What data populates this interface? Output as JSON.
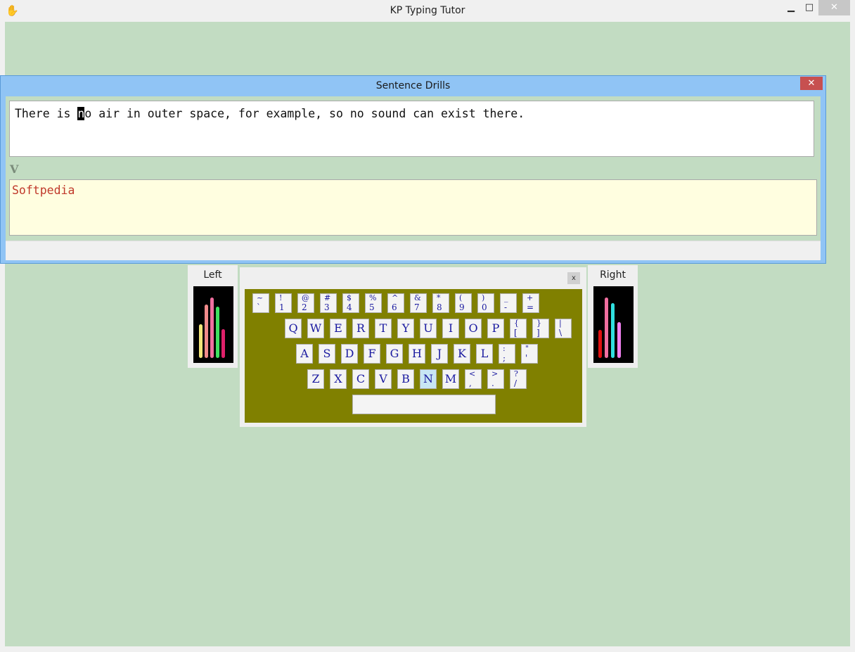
{
  "window": {
    "title": "KP Typing Tutor",
    "icon": "hand-icon",
    "minimize": "▁",
    "maximize": "□",
    "close": "✕"
  },
  "drills": {
    "title": "Sentence Drills",
    "close": "✕",
    "target_before": "There is ",
    "target_cursor": "n",
    "target_after": "o air in outer space, for example, so no sound can exist there.",
    "next_char": "V",
    "typed_text": "Softpedia",
    "status_text": ""
  },
  "fingers": {
    "left_label": "Left",
    "right_label": "Right",
    "left_bars": [
      {
        "color": "#f2e57a",
        "level": 0.5
      },
      {
        "color": "#f08a8a",
        "level": 0.8
      },
      {
        "color": "#f06fa0",
        "level": 0.9
      },
      {
        "color": "#40e060",
        "level": 0.77
      },
      {
        "color": "#e0206a",
        "level": 0.43
      }
    ],
    "right_bars": [
      {
        "color": "#e01010",
        "level": 0.42
      },
      {
        "color": "#f06fa0",
        "level": 0.9
      },
      {
        "color": "#30e0e0",
        "level": 0.82
      },
      {
        "color": "#f080f0",
        "level": 0.54
      }
    ]
  },
  "keyboard": {
    "close": "x",
    "number_row": [
      {
        "top": "~",
        "bottom": "`"
      },
      {
        "top": "!",
        "bottom": "1"
      },
      {
        "top": "@",
        "bottom": "2"
      },
      {
        "top": "#",
        "bottom": "3"
      },
      {
        "top": "$",
        "bottom": "4"
      },
      {
        "top": "%",
        "bottom": "5"
      },
      {
        "top": "^",
        "bottom": "6"
      },
      {
        "top": "&",
        "bottom": "7"
      },
      {
        "top": "*",
        "bottom": "8"
      },
      {
        "top": "(",
        "bottom": "9"
      },
      {
        "top": ")",
        "bottom": "0"
      },
      {
        "top": "_",
        "bottom": "-"
      },
      {
        "top": "+",
        "bottom": "="
      }
    ],
    "top_row": [
      "Q",
      "W",
      "E",
      "R",
      "T",
      "Y",
      "U",
      "I",
      "O",
      "P"
    ],
    "top_row_symbols": [
      {
        "top": "{",
        "bottom": "["
      },
      {
        "top": "}",
        "bottom": "]"
      },
      {
        "top": "|",
        "bottom": "\\"
      }
    ],
    "home_row": [
      "A",
      "S",
      "D",
      "F",
      "G",
      "H",
      "J",
      "K",
      "L"
    ],
    "home_row_symbols": [
      {
        "top": ":",
        "bottom": ";"
      },
      {
        "top": "\"",
        "bottom": "'"
      }
    ],
    "bottom_row": [
      "Z",
      "X",
      "C",
      "V",
      "B",
      "N",
      "M"
    ],
    "bottom_row_symbols": [
      {
        "top": "<",
        "bottom": ","
      },
      {
        "top": ">",
        "bottom": "."
      },
      {
        "top": "?",
        "bottom": "/"
      }
    ],
    "active_key": "N"
  },
  "colors": {
    "workspace": "#c2dcc2",
    "dialog_title": "#90c4f5",
    "keyboard_bg": "#808000",
    "key_text": "#1a1aa0",
    "typed_text": "#c0392b"
  }
}
